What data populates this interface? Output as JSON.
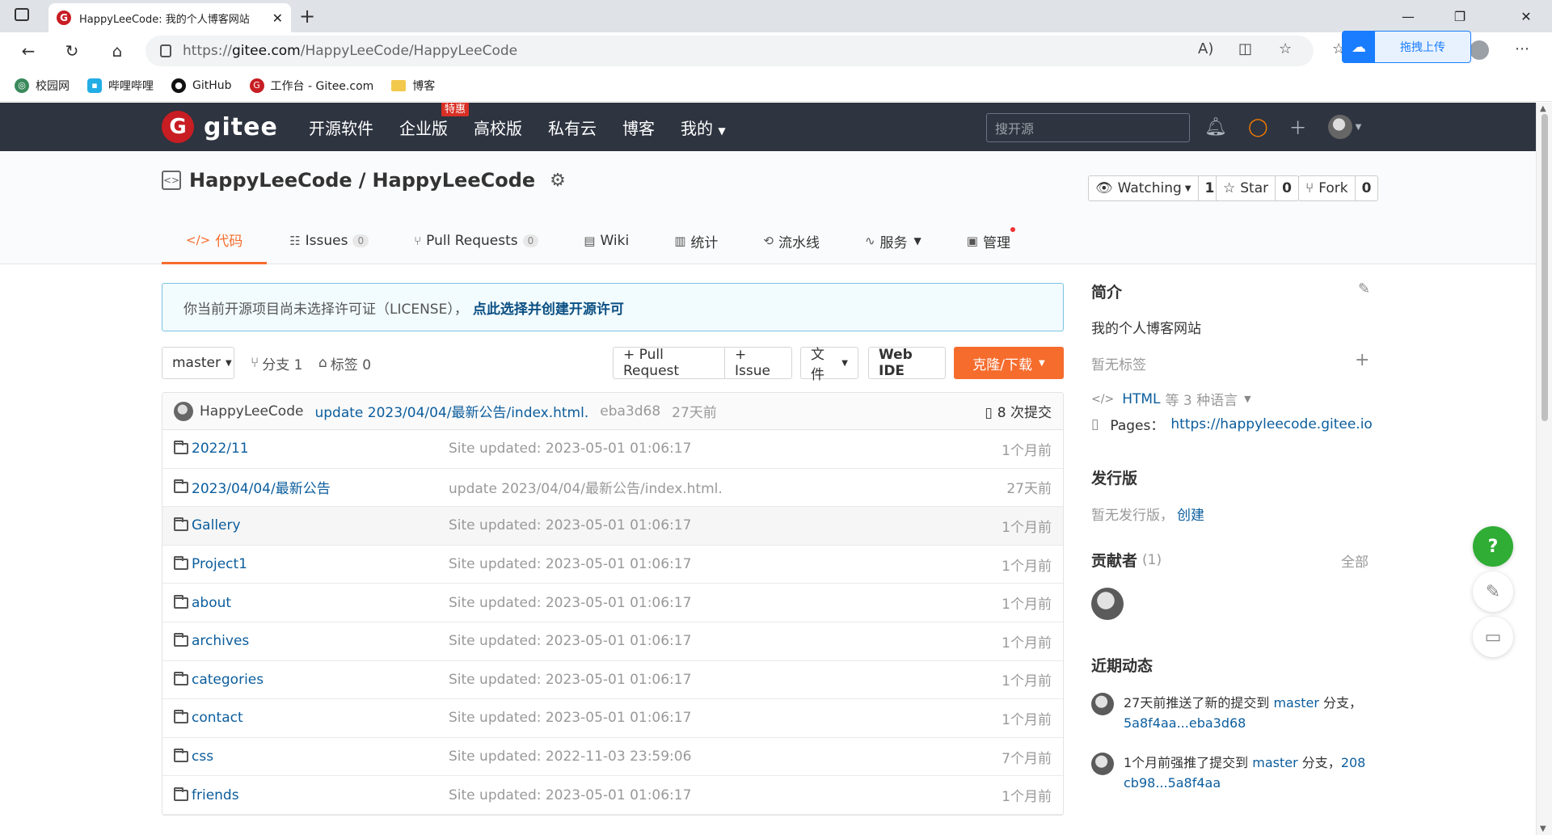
{
  "browser": {
    "tab_title": "HappyLeeCode: 我的个人博客网站",
    "url_prefix": "https://",
    "url_host": "gitee.com",
    "url_path": "/HappyLeeCode/HappyLeeCode",
    "drag_upload": "拖拽上传",
    "bookmarks": [
      {
        "label": "校园网",
        "icon": "globe-icon"
      },
      {
        "label": "哔哩哔哩",
        "icon": "bilibili-icon"
      },
      {
        "label": "GitHub",
        "icon": "github-icon"
      },
      {
        "label": "工作台 - Gitee.com",
        "icon": "gitee-icon"
      },
      {
        "label": "博客",
        "icon": "folder-icon"
      }
    ]
  },
  "header": {
    "logo_text": "gitee",
    "nav": [
      "开源软件",
      "企业版",
      "高校版",
      "私有云",
      "博客",
      "我的"
    ],
    "enterprise_badge": "特惠",
    "search_placeholder": "搜开源"
  },
  "repo": {
    "owner": "HappyLeeCode",
    "sep": "/",
    "name": "HappyLeeCode",
    "watching_label": "Watching",
    "watching_count": "1",
    "star_label": "Star",
    "star_count": "0",
    "fork_label": "Fork",
    "fork_count": "0",
    "tabs": [
      {
        "label": "代码",
        "icon": "code-icon"
      },
      {
        "label": "Issues",
        "count": "0",
        "icon": "issues-icon"
      },
      {
        "label": "Pull Requests",
        "count": "0",
        "icon": "pull-request-icon"
      },
      {
        "label": "Wiki",
        "icon": "wiki-icon"
      },
      {
        "label": "统计",
        "icon": "stats-icon"
      },
      {
        "label": "流水线",
        "icon": "pipeline-icon"
      },
      {
        "label": "服务",
        "icon": "service-icon"
      },
      {
        "label": "管理",
        "icon": "manage-icon"
      }
    ]
  },
  "license": {
    "text": "你当前开源项目尚未选择许可证（LICENSE），",
    "link": "点此选择并创建开源许可"
  },
  "toolbar": {
    "branch": "master",
    "branches": "分支 1",
    "tags": "标签 0",
    "pull_request": "+ Pull Request",
    "issue": "+ Issue",
    "files": "文件",
    "web_ide": "Web IDE",
    "clone": "克隆/下载"
  },
  "commit": {
    "author": "HappyLeeCode",
    "message": "update 2023/04/04/最新公告/index.html.",
    "sha": "eba3d68",
    "age": "27天前",
    "count": "8 次提交"
  },
  "files": [
    {
      "name": "2022/11",
      "message": "Site updated: 2023-05-01 01:06:17",
      "age": "1个月前"
    },
    {
      "name": "2023/04/04/最新公告",
      "message": "update 2023/04/04/最新公告/index.html.",
      "age": "27天前"
    },
    {
      "name": "Gallery",
      "message": "Site updated: 2023-05-01 01:06:17",
      "age": "1个月前"
    },
    {
      "name": "Project1",
      "message": "Site updated: 2023-05-01 01:06:17",
      "age": "1个月前"
    },
    {
      "name": "about",
      "message": "Site updated: 2023-05-01 01:06:17",
      "age": "1个月前"
    },
    {
      "name": "archives",
      "message": "Site updated: 2023-05-01 01:06:17",
      "age": "1个月前"
    },
    {
      "name": "categories",
      "message": "Site updated: 2023-05-01 01:06:17",
      "age": "1个月前"
    },
    {
      "name": "contact",
      "message": "Site updated: 2023-05-01 01:06:17",
      "age": "1个月前"
    },
    {
      "name": "css",
      "message": "Site updated: 2022-11-03 23:59:06",
      "age": "7个月前"
    },
    {
      "name": "friends",
      "message": "Site updated: 2023-05-01 01:06:17",
      "age": "1个月前"
    }
  ],
  "sidebar": {
    "intro_title": "简介",
    "intro_text": "我的个人博客网站",
    "no_tags": "暂无标签",
    "lang_main": "HTML",
    "lang_rest": "等 3 种语言",
    "pages_label": "Pages：",
    "pages_url": "https://happyleecode.gitee.io",
    "release_title": "发行版",
    "release_none": "暂无发行版，",
    "release_create": "创建",
    "contrib_title": "贡献者",
    "contrib_count": "(1)",
    "contrib_all": "全部",
    "activity_title": "近期动态",
    "activity": [
      {
        "text": "27天前推送了新的提交到",
        "branch": "master",
        "suffix": "分支，",
        "ref": "5a8f4aa...eba3d68"
      },
      {
        "text": "1个月前强推了提交到",
        "branch": "master",
        "suffix": "分支，",
        "ref": "208cb98...5a8f4aa"
      }
    ]
  }
}
